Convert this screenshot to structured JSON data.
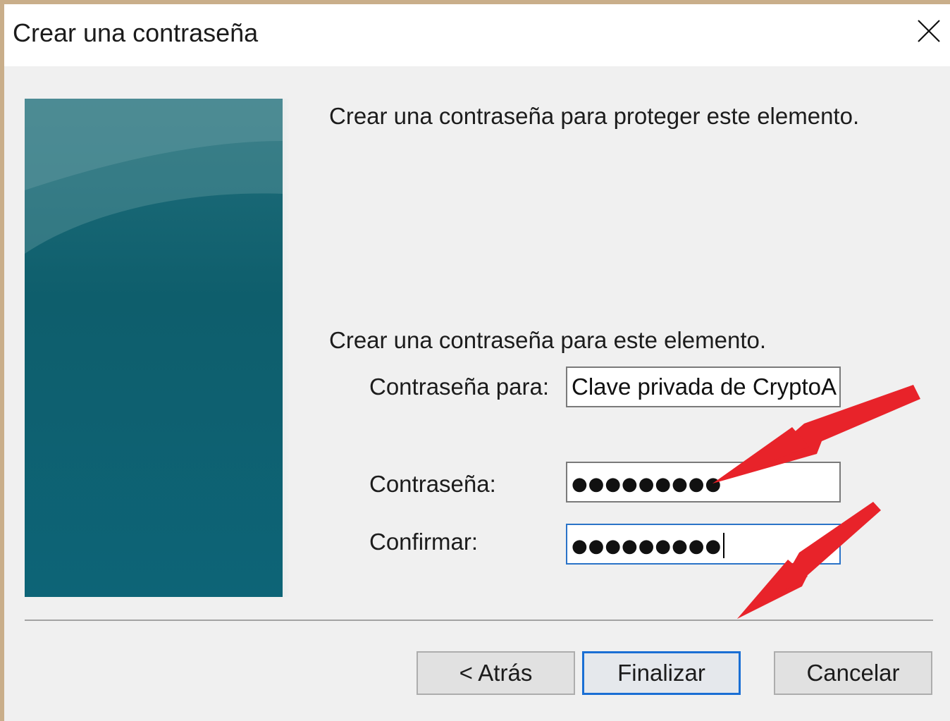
{
  "dialog": {
    "title": "Crear una contraseña",
    "close_icon": "close-icon"
  },
  "content": {
    "intro": "Crear una contraseña para proteger este elemento.",
    "instruction": "Crear una contraseña para este elemento."
  },
  "form": {
    "password_for_label": "Contraseña para:",
    "password_for_value": "Clave privada de CryptoA",
    "password_label": "Contraseña:",
    "password_masked": "●●●●●●●●●",
    "confirm_label": "Confirmar:",
    "confirm_masked": "●●●●●●●●●"
  },
  "buttons": {
    "back": "< Atrás",
    "finish": "Finalizar",
    "cancel": "Cancelar"
  },
  "colors": {
    "sidebar": "#0e5e6c",
    "focus_border": "#1a6fd4",
    "annotation_arrow": "#e8232a"
  }
}
